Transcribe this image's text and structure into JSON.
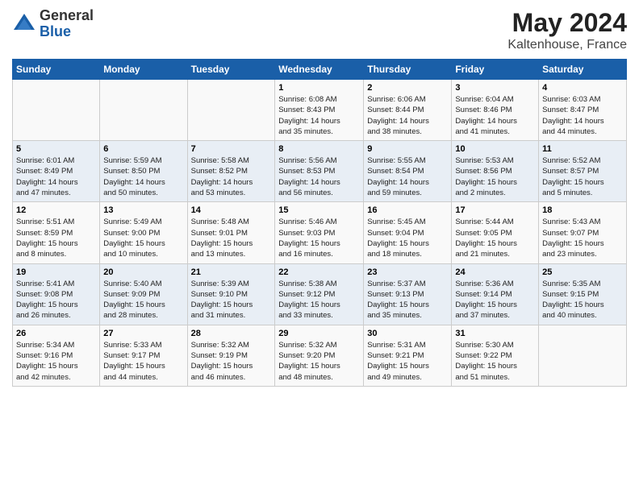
{
  "logo": {
    "general": "General",
    "blue": "Blue"
  },
  "title": "May 2024",
  "location": "Kaltenhouse, France",
  "headers": [
    "Sunday",
    "Monday",
    "Tuesday",
    "Wednesday",
    "Thursday",
    "Friday",
    "Saturday"
  ],
  "rows": [
    [
      {
        "day": "",
        "info": ""
      },
      {
        "day": "",
        "info": ""
      },
      {
        "day": "",
        "info": ""
      },
      {
        "day": "1",
        "info": "Sunrise: 6:08 AM\nSunset: 8:43 PM\nDaylight: 14 hours\nand 35 minutes."
      },
      {
        "day": "2",
        "info": "Sunrise: 6:06 AM\nSunset: 8:44 PM\nDaylight: 14 hours\nand 38 minutes."
      },
      {
        "day": "3",
        "info": "Sunrise: 6:04 AM\nSunset: 8:46 PM\nDaylight: 14 hours\nand 41 minutes."
      },
      {
        "day": "4",
        "info": "Sunrise: 6:03 AM\nSunset: 8:47 PM\nDaylight: 14 hours\nand 44 minutes."
      }
    ],
    [
      {
        "day": "5",
        "info": "Sunrise: 6:01 AM\nSunset: 8:49 PM\nDaylight: 14 hours\nand 47 minutes."
      },
      {
        "day": "6",
        "info": "Sunrise: 5:59 AM\nSunset: 8:50 PM\nDaylight: 14 hours\nand 50 minutes."
      },
      {
        "day": "7",
        "info": "Sunrise: 5:58 AM\nSunset: 8:52 PM\nDaylight: 14 hours\nand 53 minutes."
      },
      {
        "day": "8",
        "info": "Sunrise: 5:56 AM\nSunset: 8:53 PM\nDaylight: 14 hours\nand 56 minutes."
      },
      {
        "day": "9",
        "info": "Sunrise: 5:55 AM\nSunset: 8:54 PM\nDaylight: 14 hours\nand 59 minutes."
      },
      {
        "day": "10",
        "info": "Sunrise: 5:53 AM\nSunset: 8:56 PM\nDaylight: 15 hours\nand 2 minutes."
      },
      {
        "day": "11",
        "info": "Sunrise: 5:52 AM\nSunset: 8:57 PM\nDaylight: 15 hours\nand 5 minutes."
      }
    ],
    [
      {
        "day": "12",
        "info": "Sunrise: 5:51 AM\nSunset: 8:59 PM\nDaylight: 15 hours\nand 8 minutes."
      },
      {
        "day": "13",
        "info": "Sunrise: 5:49 AM\nSunset: 9:00 PM\nDaylight: 15 hours\nand 10 minutes."
      },
      {
        "day": "14",
        "info": "Sunrise: 5:48 AM\nSunset: 9:01 PM\nDaylight: 15 hours\nand 13 minutes."
      },
      {
        "day": "15",
        "info": "Sunrise: 5:46 AM\nSunset: 9:03 PM\nDaylight: 15 hours\nand 16 minutes."
      },
      {
        "day": "16",
        "info": "Sunrise: 5:45 AM\nSunset: 9:04 PM\nDaylight: 15 hours\nand 18 minutes."
      },
      {
        "day": "17",
        "info": "Sunrise: 5:44 AM\nSunset: 9:05 PM\nDaylight: 15 hours\nand 21 minutes."
      },
      {
        "day": "18",
        "info": "Sunrise: 5:43 AM\nSunset: 9:07 PM\nDaylight: 15 hours\nand 23 minutes."
      }
    ],
    [
      {
        "day": "19",
        "info": "Sunrise: 5:41 AM\nSunset: 9:08 PM\nDaylight: 15 hours\nand 26 minutes."
      },
      {
        "day": "20",
        "info": "Sunrise: 5:40 AM\nSunset: 9:09 PM\nDaylight: 15 hours\nand 28 minutes."
      },
      {
        "day": "21",
        "info": "Sunrise: 5:39 AM\nSunset: 9:10 PM\nDaylight: 15 hours\nand 31 minutes."
      },
      {
        "day": "22",
        "info": "Sunrise: 5:38 AM\nSunset: 9:12 PM\nDaylight: 15 hours\nand 33 minutes."
      },
      {
        "day": "23",
        "info": "Sunrise: 5:37 AM\nSunset: 9:13 PM\nDaylight: 15 hours\nand 35 minutes."
      },
      {
        "day": "24",
        "info": "Sunrise: 5:36 AM\nSunset: 9:14 PM\nDaylight: 15 hours\nand 37 minutes."
      },
      {
        "day": "25",
        "info": "Sunrise: 5:35 AM\nSunset: 9:15 PM\nDaylight: 15 hours\nand 40 minutes."
      }
    ],
    [
      {
        "day": "26",
        "info": "Sunrise: 5:34 AM\nSunset: 9:16 PM\nDaylight: 15 hours\nand 42 minutes."
      },
      {
        "day": "27",
        "info": "Sunrise: 5:33 AM\nSunset: 9:17 PM\nDaylight: 15 hours\nand 44 minutes."
      },
      {
        "day": "28",
        "info": "Sunrise: 5:32 AM\nSunset: 9:19 PM\nDaylight: 15 hours\nand 46 minutes."
      },
      {
        "day": "29",
        "info": "Sunrise: 5:32 AM\nSunset: 9:20 PM\nDaylight: 15 hours\nand 48 minutes."
      },
      {
        "day": "30",
        "info": "Sunrise: 5:31 AM\nSunset: 9:21 PM\nDaylight: 15 hours\nand 49 minutes."
      },
      {
        "day": "31",
        "info": "Sunrise: 5:30 AM\nSunset: 9:22 PM\nDaylight: 15 hours\nand 51 minutes."
      },
      {
        "day": "",
        "info": ""
      }
    ]
  ]
}
